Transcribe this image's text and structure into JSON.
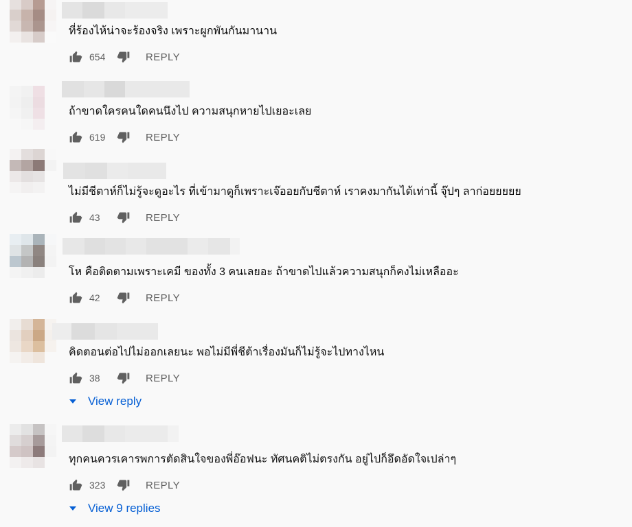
{
  "reply_label": "REPLY",
  "comments": [
    {
      "text": "ที่ร้องไห้น่าจะร้องจริง เพราะผูกพันกันมานาน",
      "likes": "654"
    },
    {
      "text": "ถ้าขาดใครคนใดคนนึงไป ความสนุกหายไปเยอะเลย",
      "likes": "619"
    },
    {
      "text": "ไม่มีชีตาห์ก็ไม่รู้จะดูอะไร ที่เข้ามาดูก็เพราะเจ๊ออยกับชีตาห์ เราคงมากันได้เท่านี้ จุ๊ปๆ ลาก่อยยยยย",
      "likes": "43"
    },
    {
      "text": "โห คือติดตามเพราะเคมี ของทั้ง 3 คนเลยอะ ถ้าขาดไปแล้วความสนุกก็คงไม่เหลืออะ",
      "likes": "42"
    },
    {
      "text": "คิดตอนต่อไปไม่ออกเลยนะ พอไม่มีพี่ชีต้าเรื่องมันก็ไม่รู้จะไปทางไหน",
      "likes": "38",
      "view_replies": "View reply"
    },
    {
      "text": "ทุกคนควรเคารพการตัดสินใจของพี่อ๊อฟนะ ทัศนคติไม่ตรงกัน อยู่ไปก็อึดอัดใจเปล่าๆ",
      "likes": "323",
      "view_replies": "View 9 replies"
    }
  ],
  "colors": {
    "accent": "#065fd4",
    "secondary_text": "#606060",
    "background": "#f9f9f9"
  },
  "icons": [
    "thumbs-up-icon",
    "thumbs-down-icon",
    "caret-down-icon"
  ]
}
